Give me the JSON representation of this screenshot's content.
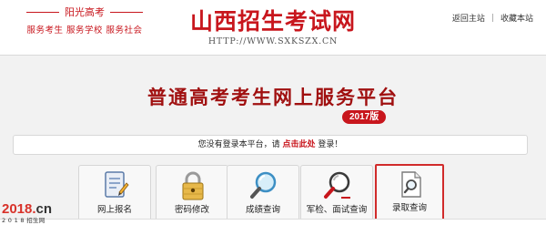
{
  "header": {
    "slogan_top": "阳光高考",
    "slogan_bottom": "服务考生  服务学校  服务社会",
    "site_name": "山西招生考试网",
    "site_url": "HTTP://WWW.SXKSZX.CN",
    "links": {
      "home": "返回主站",
      "favorite": "收藏本站",
      "separator": "|"
    }
  },
  "platform": {
    "title": "普通高考考生网上服务平台",
    "year_badge": "2017版"
  },
  "notice": {
    "prefix": "您没有登录本平台，请",
    "link": "点击此处",
    "suffix": "登录！"
  },
  "menu": [
    {
      "label": "网上报名",
      "icon": "form-edit-icon"
    },
    {
      "label": "密码修改",
      "icon": "padlock-icon"
    },
    {
      "label": "成绩查询",
      "icon": "magnifier-icon"
    },
    {
      "label": "军检、面试查询",
      "icon": "magnifier-red-icon"
    },
    {
      "label": "录取查询",
      "icon": "document-search-icon",
      "selected": true
    }
  ],
  "watermark": {
    "number": "2018",
    "dot": ".",
    "cn": "cn",
    "sub": "2 0 1 8 招生网"
  },
  "colors": {
    "brand_red": "#c8161d",
    "title_red": "#a01010",
    "highlight_border": "#d12b2b"
  }
}
